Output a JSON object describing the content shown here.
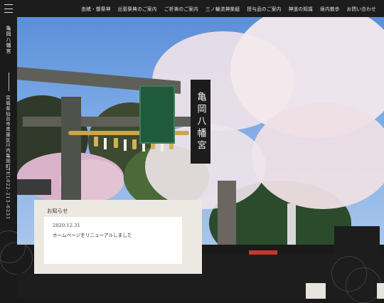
{
  "nav": {
    "items": [
      "由緒・御祭神",
      "出張祭典のご案内",
      "ご祈祷のご案内",
      "三ノ輪流神楽組",
      "授与品のご案内",
      "神道の知識",
      "境内散歩",
      "お問い合わせ"
    ]
  },
  "sidebar": {
    "site_name": "亀岡八幡宮",
    "address": "宮城県仙台市青葉区川内亀岡町",
    "tel": "TEL022-213-6231"
  },
  "hero": {
    "sign_text": "亀岡八幡宮"
  },
  "news": {
    "heading": "お知らせ",
    "items": [
      {
        "date": "2020.12.31",
        "text": "ホームページをリニューアルしました"
      }
    ]
  },
  "colors": {
    "bar": "#1c1c1c",
    "news_bg": "#ece9e2",
    "sky": "#6b9ade"
  }
}
